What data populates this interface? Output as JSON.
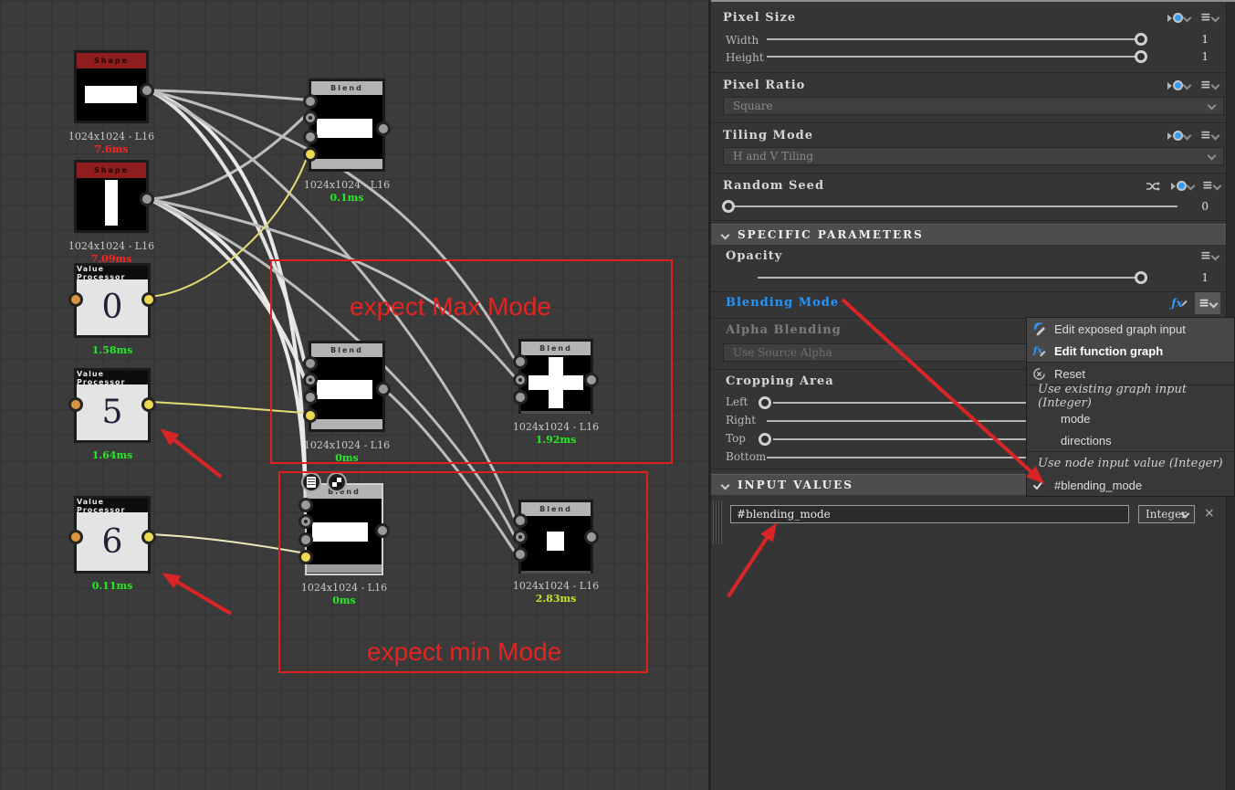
{
  "colors": {
    "annotation_red": "#e32421",
    "wire_gray": "#bdbdbd",
    "wire_yellow": "#e4dc72",
    "blending_blue": "#2196ff",
    "time_green": "#27e827",
    "time_red": "#ff2222"
  },
  "graph": {
    "nodes": [
      {
        "title": "Shape",
        "res": "1024x1024 - L16",
        "time": "7.6ms"
      },
      {
        "title": "Shape",
        "res": "1024x1024 - L16",
        "time": "7.09ms"
      },
      {
        "title": "Value Processor",
        "value": "0",
        "time": "1.58ms"
      },
      {
        "title": "Value Processor",
        "value": "5",
        "time": "1.64ms"
      },
      {
        "title": "Value Processor",
        "value": "6",
        "time": "0.11ms"
      },
      {
        "title": "Blend",
        "res": "1024x1024 - L16",
        "time": "0.1ms"
      },
      {
        "title": "Blend",
        "res": "1024x1024 - L16",
        "time": "0ms"
      },
      {
        "title": "Blend",
        "res": "1024x1024 - L16",
        "time": "1.92ms"
      },
      {
        "title": "Blend",
        "res": "1024x1024 - L16",
        "time": "0ms"
      },
      {
        "title": "Blend",
        "res": "1024x1024 - L16",
        "time": "2.83ms"
      }
    ],
    "annotations": {
      "max": "expect Max Mode",
      "min": "expect min Mode"
    }
  },
  "panel": {
    "pixel_size": {
      "title": "Pixel Size",
      "width_label": "Width",
      "width_value": "1",
      "height_label": "Height",
      "height_value": "1"
    },
    "pixel_ratio": {
      "title": "Pixel Ratio",
      "value": "Square"
    },
    "tiling_mode": {
      "title": "Tiling Mode",
      "value": "H and V Tiling"
    },
    "random_seed": {
      "title": "Random Seed",
      "value": "0"
    },
    "specific_parameters": {
      "title": "SPECIFIC PARAMETERS"
    },
    "opacity": {
      "title": "Opacity",
      "value": "1"
    },
    "blending_mode": {
      "title": "Blending Mode"
    },
    "alpha_blending": {
      "title": "Alpha Blending",
      "value": "Use Source Alpha"
    },
    "cropping_area": {
      "title": "Cropping Area",
      "left_label": "Left",
      "right_label": "Right",
      "top_label": "Top",
      "bottom_label": "Bottom"
    },
    "input_values": {
      "title": "INPUT VALUES",
      "value": "#blending_mode",
      "type": "Integer",
      "close": "×"
    }
  },
  "menu": {
    "items": [
      {
        "label": "Edit exposed graph input"
      },
      {
        "label": "Edit function graph"
      },
      {
        "label": "Reset"
      },
      {
        "label": "Use existing graph input (Integer)"
      },
      {
        "label": "mode"
      },
      {
        "label": "directions"
      },
      {
        "label": "Use node input value (Integer)"
      },
      {
        "label": "#blending_mode"
      }
    ]
  }
}
